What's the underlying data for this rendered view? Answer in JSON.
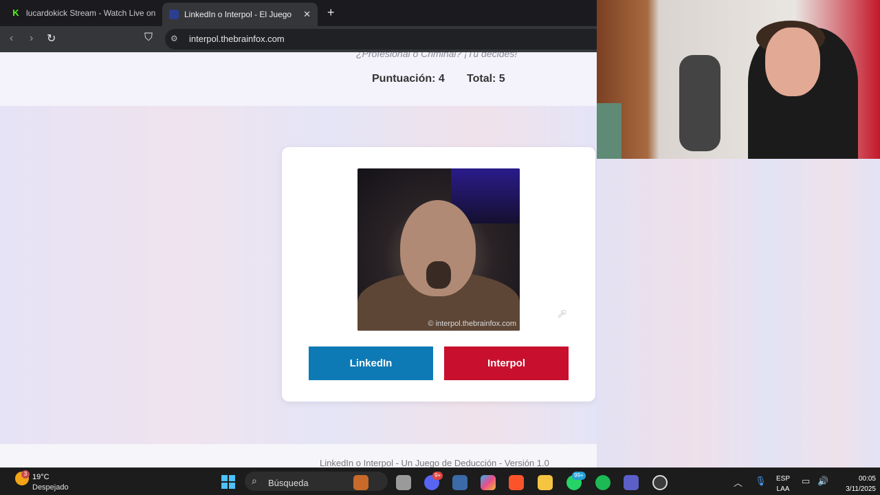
{
  "browser": {
    "tabs": [
      {
        "label": "lucardokick Stream - Watch Live on K",
        "active": false
      },
      {
        "label": "LinkedIn o Interpol - El Juego",
        "active": true
      }
    ],
    "url": "interpol.thebrainfox.com"
  },
  "page": {
    "subtitle": "¿Profesional o Criminal? ¡Tú decides!",
    "score_label": "Puntuación: 4",
    "total_label": "Total: 5",
    "photo_watermark": "© interpol.thebrainfox.com",
    "buttons": {
      "linkedin": "LinkedIn",
      "interpol": "Interpol"
    },
    "footer": "LinkedIn o Interpol - Un Juego de Deducción - Versión 1.0"
  },
  "colors": {
    "linkedin": "#0e7ab5",
    "interpol": "#c8102e"
  },
  "taskbar": {
    "weather_temp": "19°C",
    "weather_condition": "Despejado",
    "weather_badge": "3",
    "search_placeholder": "Búsqueda",
    "discord_badge": "9+",
    "whatsapp_badge": "99+",
    "lang_top": "ESP",
    "lang_bottom": "LAA",
    "time": "00:05",
    "date": "3/11/2025"
  }
}
